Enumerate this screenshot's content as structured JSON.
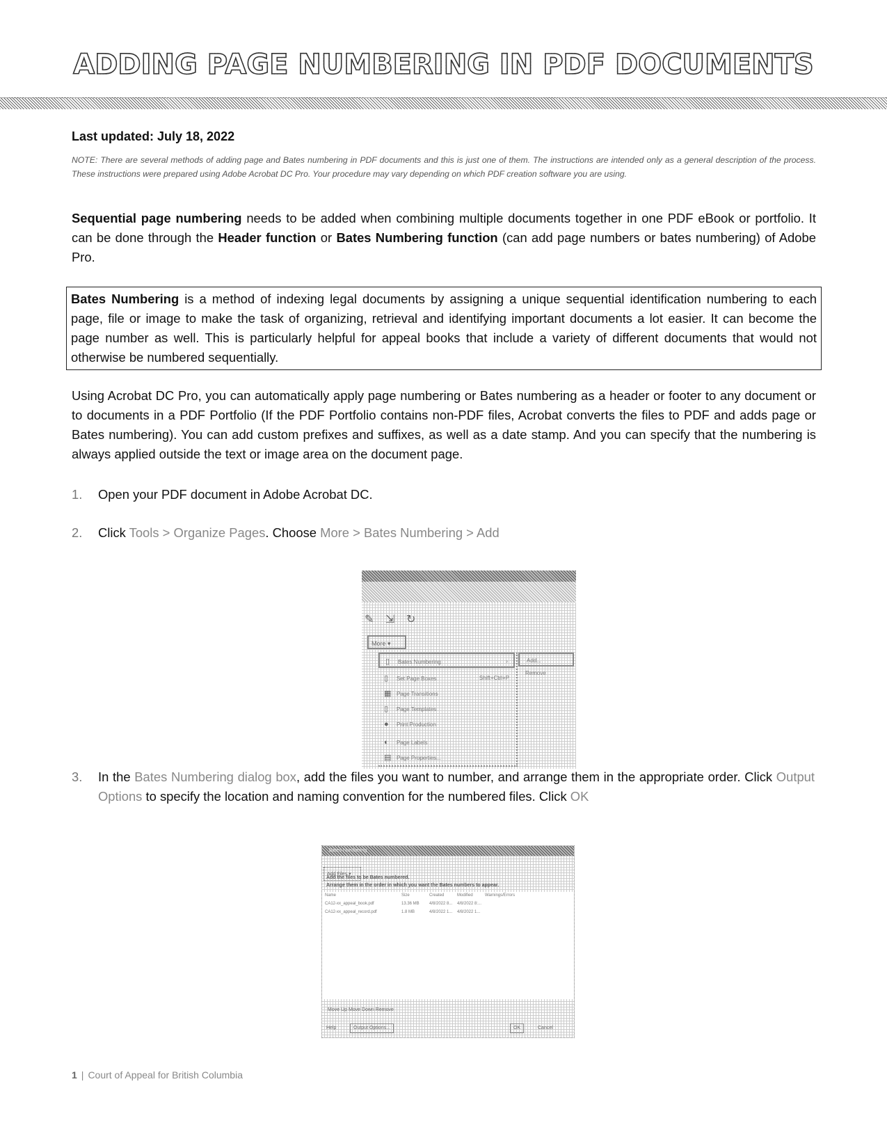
{
  "title": "ADDING PAGE NUMBERING IN PDF DOCUMENTS",
  "last_updated": "Last updated: July 18, 2022",
  "note": "NOTE: There are several methods of adding page and Bates numbering in PDF documents and this is just one of them. The instructions are intended only as a general description of the process. These instructions were prepared using Adobe Acrobat DC Pro. Your procedure may vary depending on which PDF creation software you are using.",
  "intro": {
    "bold1": "Sequential page numbering",
    "text1": " needs to be added when combining multiple documents together in one PDF eBook or portfolio.  It can be done through the ",
    "bold2": "Header function",
    "text2": " or ",
    "bold3": "Bates Numbering function",
    "text3": " (can add page numbers or bates numbering) of Adobe Pro."
  },
  "definition": {
    "bold": "Bates Numbering",
    "text": " is a method of indexing legal documents by assigning a unique sequential identification numbering to each page, file or image to make the task of organizing, retrieval and identifying important documents a lot easier. It can become the page number as well. This is particularly helpful for appeal books that include a variety of different documents that would not otherwise be numbered sequentially."
  },
  "overview": "Using Acrobat DC Pro, you can automatically apply page numbering or Bates numbering as a header or footer to any document or to documents in a PDF Portfolio (If the PDF Portfolio contains non-PDF files, Acrobat converts the files to PDF and adds page or Bates numbering). You can add custom prefixes and suffixes, as well as a date stamp. And you can specify that the numbering is always applied outside the text or image area on the document page.",
  "steps": [
    {
      "num": "1.",
      "text": "Open your PDF document in Adobe Acrobat DC."
    },
    {
      "num": "2.",
      "pre": "Click ",
      "hl1": "Tools > Organize Pages",
      "mid": ". Choose ",
      "hl2": "More > Bates Numbering > Add"
    },
    {
      "num": "3.",
      "pre": "In the ",
      "hl1": "Bates Numbering dialog box",
      "mid": ", add the files you want to number, and arrange them in the appropriate order. Click ",
      "hl2": "Output Options",
      "mid2": " to specify the location and naming convention for the numbered files. Click ",
      "hl3": "OK"
    }
  ],
  "screenshot1": {
    "more_button": "More ▾",
    "menu_items": [
      {
        "label": "Bates Numbering",
        "icon": "bates-icon",
        "glyph": "▯",
        "shortcut": "›"
      },
      {
        "label": "Set Page Boxes",
        "icon": "page-boxes-icon",
        "glyph": "▯",
        "shortcut": "Shift+Ctrl+P"
      },
      {
        "label": "Page Transitions",
        "icon": "transitions-icon",
        "glyph": "▦",
        "shortcut": ""
      },
      {
        "label": "Page Templates",
        "icon": "templates-icon",
        "glyph": "▯",
        "shortcut": ""
      },
      {
        "label": "Print Production",
        "icon": "print-icon",
        "glyph": "●",
        "shortcut": ""
      },
      {
        "label": "Page Labels",
        "icon": "labels-icon",
        "glyph": "◐",
        "shortcut": ""
      },
      {
        "label": "Page Properties...",
        "icon": "properties-icon",
        "glyph": "▤",
        "shortcut": ""
      }
    ],
    "submenu": [
      "Add...",
      "Remove"
    ]
  },
  "screenshot2": {
    "title": "Bates Numbering",
    "add_files": "Add Files ▾",
    "instruction1": "Add the files to be Bates numbered.",
    "instruction2": "Arrange them in the order in which you want the Bates numbers to appear.",
    "columns": [
      "Name",
      "Size",
      "Created",
      "Modified",
      "Warnings/Errors"
    ],
    "rows": [
      [
        "CA12-xx_appeal_book.pdf",
        "13.36 MB",
        "4/8/2022 8...",
        "4/8/2022 8:..."
      ],
      [
        "CA12-xx_appeal_record.pdf",
        "1.8 MB",
        "4/8/2022 1...",
        "4/8/2022 1..."
      ]
    ],
    "list_tools": "Move Up   Move Down   Remove",
    "help": "Help",
    "output_options": "Output Options...",
    "ok": "OK",
    "cancel": "Cancel"
  },
  "footer": {
    "page": "1",
    "org": "Court of Appeal for British Columbia"
  }
}
